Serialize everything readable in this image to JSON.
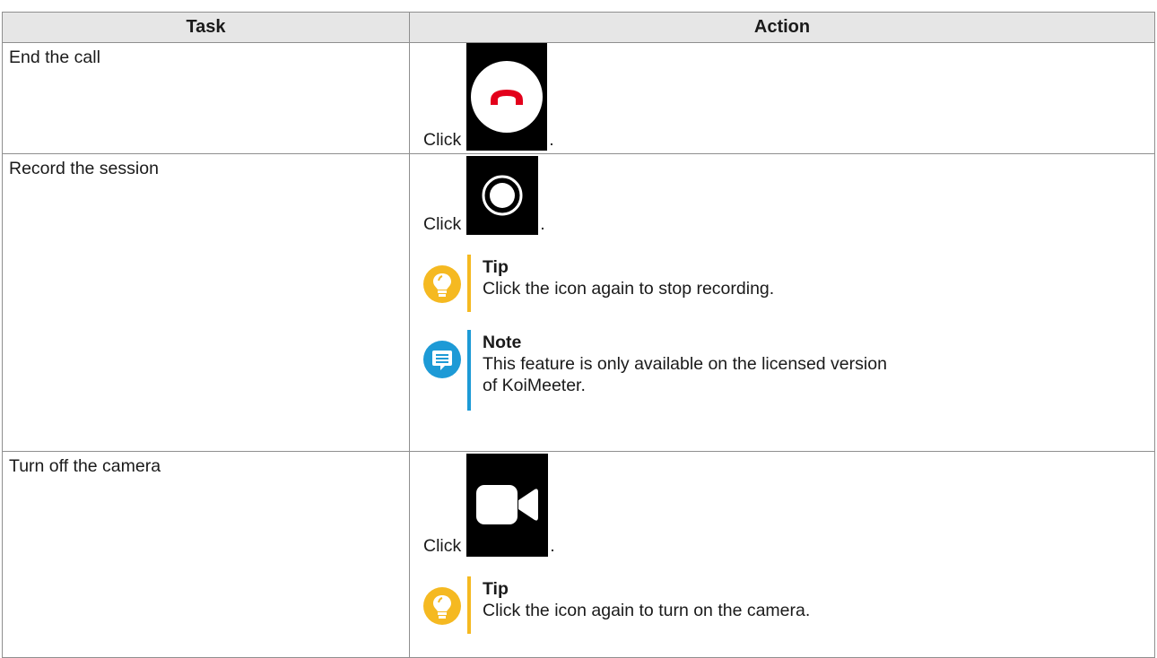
{
  "table": {
    "header": {
      "task": "Task",
      "action": "Action"
    },
    "rows": [
      {
        "task": "End the call",
        "click_word": "Click",
        "period": ".",
        "icon": "end-call-icon"
      },
      {
        "task": "Record the session",
        "click_word": "Click",
        "period": ".",
        "icon": "record-icon",
        "tip": {
          "title": "Tip",
          "text": "Click the icon again to stop recording."
        },
        "note": {
          "title": "Note",
          "text_line1": "This feature is only available on the licensed version",
          "text_line2": "of KoiMeeter."
        }
      },
      {
        "task": "Turn off the camera",
        "click_word": "Click",
        "period": ".",
        "icon": "camera-icon",
        "tip": {
          "title": "Tip",
          "text": "Click the icon again to turn on the camera."
        }
      }
    ]
  },
  "colors": {
    "tip_accent": "#f5b921",
    "note_accent": "#1d9ad6",
    "end_call_red": "#e3001b",
    "header_bg": "#e6e6e6"
  }
}
